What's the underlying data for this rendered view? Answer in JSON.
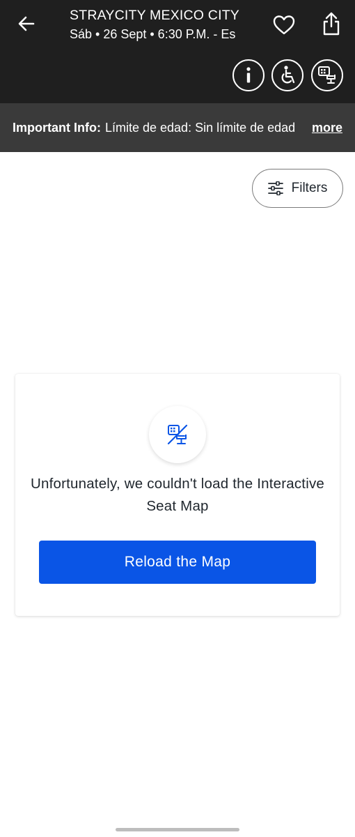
{
  "header": {
    "title": "STRAYCITY MEXICO CITY",
    "subtitle": "Sáb • 26 Sept • 6:30 P.M. - Es",
    "back_icon": "arrow-left-icon",
    "favorite_icon": "heart-outline-icon",
    "share_icon": "share-icon",
    "actions": [
      {
        "icon": "info-icon"
      },
      {
        "icon": "accessibility-icon"
      },
      {
        "icon": "seat-map-icon"
      }
    ]
  },
  "info_bar": {
    "label": "Important Info:",
    "text": "Límite de edad: Sin límite de edad",
    "more": "more"
  },
  "filters": {
    "label": "Filters",
    "icon": "sliders-icon"
  },
  "error_card": {
    "icon": "seat-map-unavailable-icon",
    "message": "Unfortunately, we couldn't load the Interactive Seat Map",
    "button_label": "Reload the Map"
  },
  "colors": {
    "topbar_bg": "#1f1f1f",
    "infobar_bg": "#3a3a3a",
    "primary": "#0a55e6",
    "text": "#1f262d"
  }
}
